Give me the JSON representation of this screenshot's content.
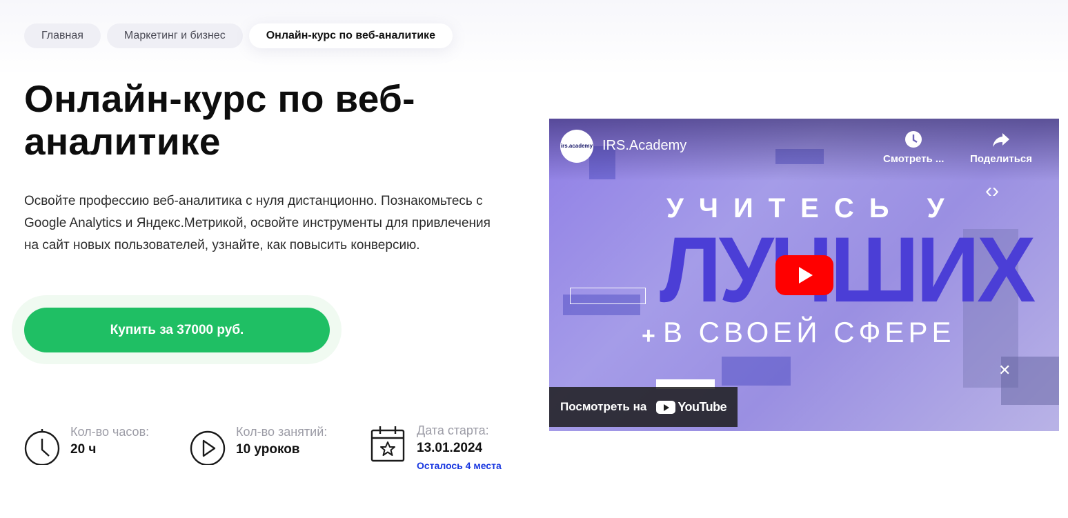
{
  "breadcrumbs": [
    "Главная",
    "Маркетинг и бизнес",
    "Онлайн-курс по веб-аналитике"
  ],
  "title": "Онлайн-курс по веб-аналитике",
  "description": "Освойте профессию веб-аналитика с нуля дистанционно. Познакомьтесь с Google Analytics и Яндекс.Метрикой, освойте инструменты для привлечения на сайт новых пользователей, узнайте, как повысить конверсию.",
  "buy_label": "Купить за 37000 руб.",
  "stats": {
    "hours": {
      "label": "Кол-во часов:",
      "value": "20 ч",
      "icon": "clock-icon"
    },
    "lessons": {
      "label": "Кол-во занятий:",
      "value": "10 уроков",
      "icon": "play-circle-icon"
    },
    "start": {
      "label": "Дата старта:",
      "value": "13.01.2024",
      "note": "Осталось 4 места",
      "icon": "calendar-star-icon"
    }
  },
  "video": {
    "avatar_text": "irs.academy",
    "channel": "IRS.Academy",
    "watch_later": "Смотреть ...",
    "share": "Поделиться",
    "line1": "УЧИТЕСЬ У",
    "line2": "ЛУЧШИХ",
    "line3": "В СВОЕЙ СФЕРЕ",
    "watch_on": "Посмотреть на",
    "youtube": "YouTube"
  },
  "colors": {
    "accent_green": "#1fbf64",
    "note_blue": "#1736e0",
    "youtube_red": "#ff0000"
  }
}
